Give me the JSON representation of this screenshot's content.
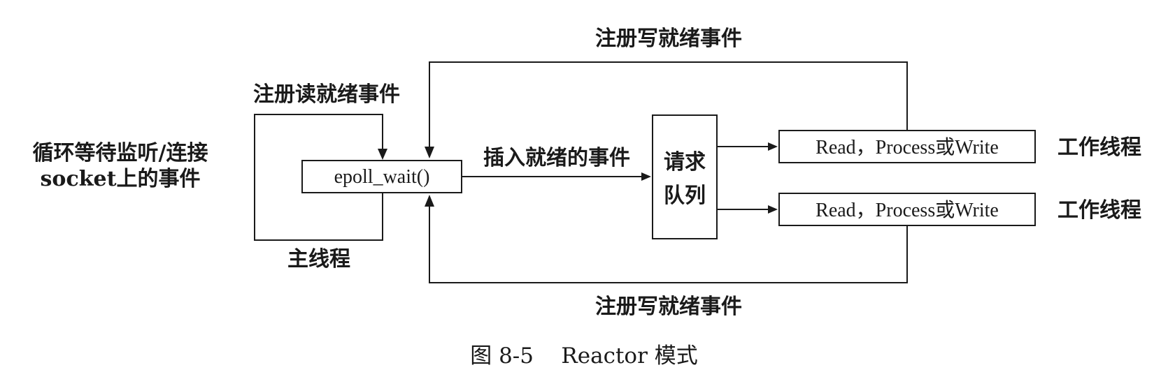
{
  "diagram": {
    "caption": "图 8-5    Reactor 模式",
    "left_note": {
      "line1": "循环等待监听/连接",
      "line2": "socket上的事件"
    },
    "main_thread": {
      "register_read_label": "注册读就绪事件",
      "epoll_label": "epoll_wait()",
      "thread_label": "主线程"
    },
    "insert_label": "插入就绪的事件",
    "queue": {
      "line1": "请求",
      "line2": "队列"
    },
    "register_write_top": "注册写就绪事件",
    "register_write_bottom": "注册写就绪事件",
    "workers": [
      {
        "task_label": "Read，Process或Write",
        "thread_label": "工作线程"
      },
      {
        "task_label": "Read，Process或Write",
        "thread_label": "工作线程"
      }
    ]
  }
}
